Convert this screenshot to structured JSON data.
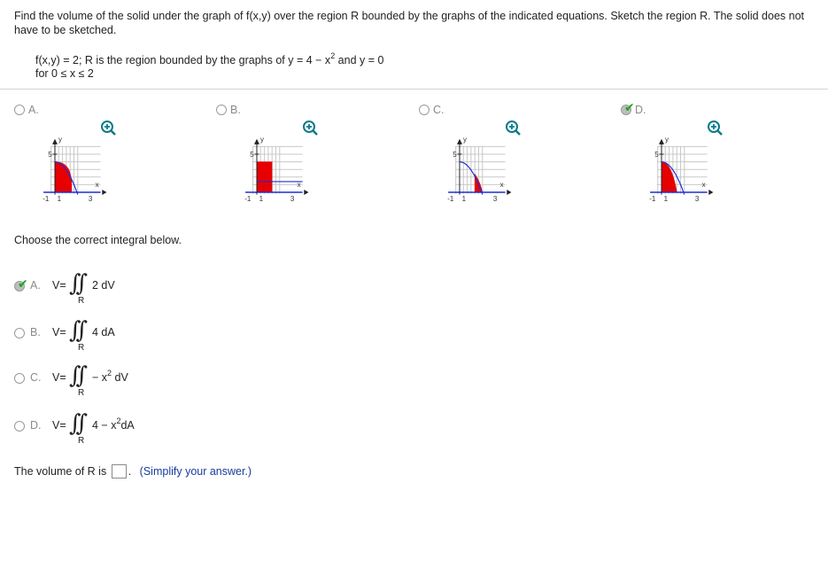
{
  "problem": {
    "text": "Find the volume of the solid under the graph of f(x,y) over the region R bounded by the graphs of the indicated equations. Sketch the region R. The solid does not have to be sketched.",
    "given_line1_pre": "f(x,y) = 2; R is the region bounded by the graphs of y = 4 − x",
    "given_line1_exp": "2",
    "given_line1_post": " and y = 0",
    "given_line2": "for 0 ≤ x ≤ 2"
  },
  "graph_options": [
    {
      "label": "A.",
      "selected": false
    },
    {
      "label": "B.",
      "selected": false
    },
    {
      "label": "C.",
      "selected": false
    },
    {
      "label": "D.",
      "selected": true
    }
  ],
  "graph_axis": {
    "y_label": "y",
    "x_label": "x",
    "y_tick": "5",
    "x_left_tick": "-1",
    "x_origin_tick": "1",
    "x_right_tick": "3"
  },
  "colors": {
    "fill": "#e60000",
    "curve": "#1f2fd6",
    "grid": "#c8c8c8",
    "check": "#1fa31f",
    "zoom": "#0a7a8a"
  },
  "question": {
    "choose_text": "Choose the correct integral below."
  },
  "integral_options": [
    {
      "label": "A.",
      "selected": true,
      "v": "V=",
      "integrand_pre": "2 dV",
      "exp": "",
      "integrand_post": "",
      "region": "R"
    },
    {
      "label": "B.",
      "selected": false,
      "v": "V=",
      "integrand_pre": "4 dA",
      "exp": "",
      "integrand_post": "",
      "region": "R"
    },
    {
      "label": "C.",
      "selected": false,
      "v": "V=",
      "integrand_pre": "− x",
      "exp": "2",
      "integrand_post": " dV",
      "region": "R"
    },
    {
      "label": "D.",
      "selected": false,
      "v": "V=",
      "integrand_pre": "4 − x",
      "exp": "2",
      "integrand_post": "dA",
      "region": "R"
    }
  ],
  "volume": {
    "text": "The volume of R is",
    "period": ".",
    "hint": "(Simplify your answer.)"
  }
}
